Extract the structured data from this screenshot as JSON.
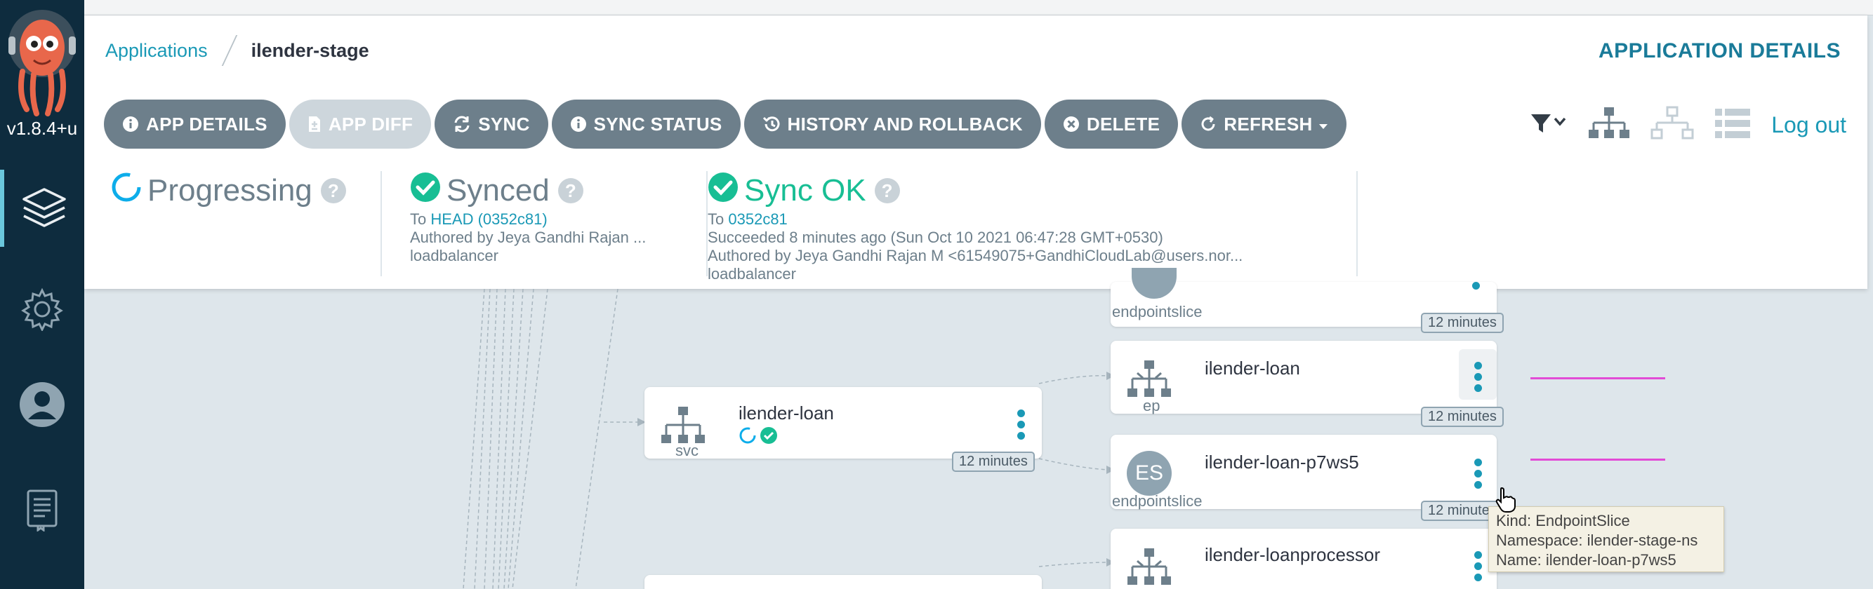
{
  "sidebar": {
    "version": "v1.8.4+u",
    "items": [
      {
        "name": "applications",
        "icon": "layers-icon"
      },
      {
        "name": "settings",
        "icon": "gear-icon"
      },
      {
        "name": "user-info",
        "icon": "user-icon"
      },
      {
        "name": "documentation",
        "icon": "docs-icon"
      }
    ]
  },
  "header": {
    "breadcrumb": {
      "root": "Applications",
      "current": "ilender-stage"
    },
    "title": "APPLICATION DETAILS",
    "logout": "Log out"
  },
  "toolbar": {
    "buttons": [
      {
        "label": "APP DETAILS",
        "icon": "info-icon"
      },
      {
        "label": "APP DIFF",
        "icon": "file-diff-icon",
        "disabled": true
      },
      {
        "label": "SYNC",
        "icon": "sync-icon"
      },
      {
        "label": "SYNC STATUS",
        "icon": "info-icon"
      },
      {
        "label": "HISTORY AND ROLLBACK",
        "icon": "history-icon"
      },
      {
        "label": "DELETE",
        "icon": "times-circle-icon"
      },
      {
        "label": "REFRESH",
        "icon": "refresh-icon",
        "dropdown": true
      }
    ]
  },
  "status": {
    "health": {
      "label": "Progressing",
      "help": "?"
    },
    "sync": {
      "label": "Synced",
      "help": "?",
      "to_prefix": "To",
      "to_link": "HEAD (0352c81)",
      "author": "Authored by Jeya Gandhi Rajan ...",
      "message": "loadbalancer"
    },
    "operation": {
      "label": "Sync OK",
      "help": "?",
      "to_prefix": "To",
      "to_link": "0352c81",
      "time": "Succeeded 8 minutes ago (Sun Oct 10 2021 06:47:28 GMT+0530)",
      "author": "Authored by Jeya Gandhi Rajan M <61549075+GandhiCloudLab@users.nor...",
      "message": "loadbalancer"
    },
    "colors": {
      "progressing": "#0dadea",
      "synced": "#18be94"
    }
  },
  "graph": {
    "nodes": {
      "svc": {
        "name": "ilender-loan",
        "kind": "svc",
        "age": "12 minutes"
      },
      "slice_top": {
        "kind": "endpointslice",
        "age": "12 minutes"
      },
      "ep": {
        "name": "ilender-loan",
        "kind": "ep",
        "age": "12 minutes"
      },
      "es": {
        "name": "ilender-loan-p7ws5",
        "kind": "endpointslice",
        "badge": "ES",
        "age": "12 minutes"
      },
      "ep2": {
        "name": "ilender-loanprocessor"
      }
    }
  },
  "tooltip": {
    "kind": "Kind: EndpointSlice",
    "namespace": "Namespace: ilender-stage-ns",
    "name": "Name: ilender-loan-p7ws5"
  }
}
